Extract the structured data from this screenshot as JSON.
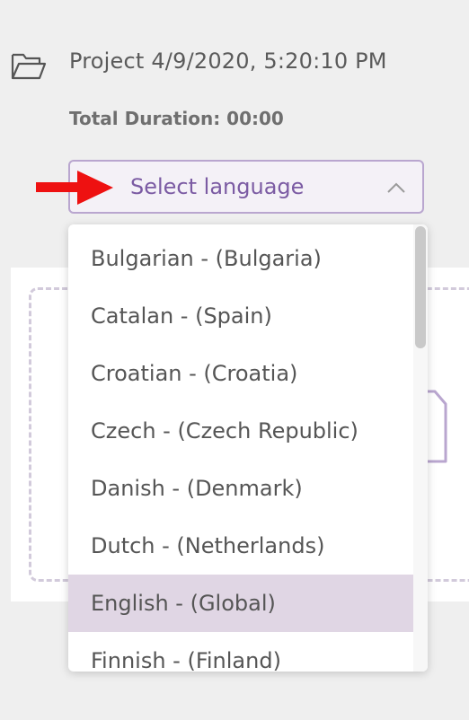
{
  "project": {
    "title": "Project 4/9/2020, 5:20:10 PM",
    "duration": "Total Duration: 00:00"
  },
  "language_select": {
    "label": "Select language",
    "state": "open"
  },
  "language_options": [
    {
      "label": "Bulgarian - (Bulgaria)"
    },
    {
      "label": "Catalan - (Spain)"
    },
    {
      "label": "Croatian - (Croatia)"
    },
    {
      "label": "Czech - (Czech Republic)"
    },
    {
      "label": "Danish - (Denmark)"
    },
    {
      "label": "Dutch - (Netherlands)"
    },
    {
      "label": "English - (Global)"
    },
    {
      "label": "Finnish - (Finland)"
    }
  ],
  "highlighted_option": "English - (Global)",
  "icons": {
    "folder": "folder-icon",
    "chevron": "chevron-up-icon",
    "arrow": "arrow-right-icon",
    "file": "file-icon"
  },
  "colors": {
    "accent": "#7b5ba3",
    "select_border": "#b9a6cf",
    "highlight": "#e0d6e4",
    "arrow": "#ee1111"
  }
}
